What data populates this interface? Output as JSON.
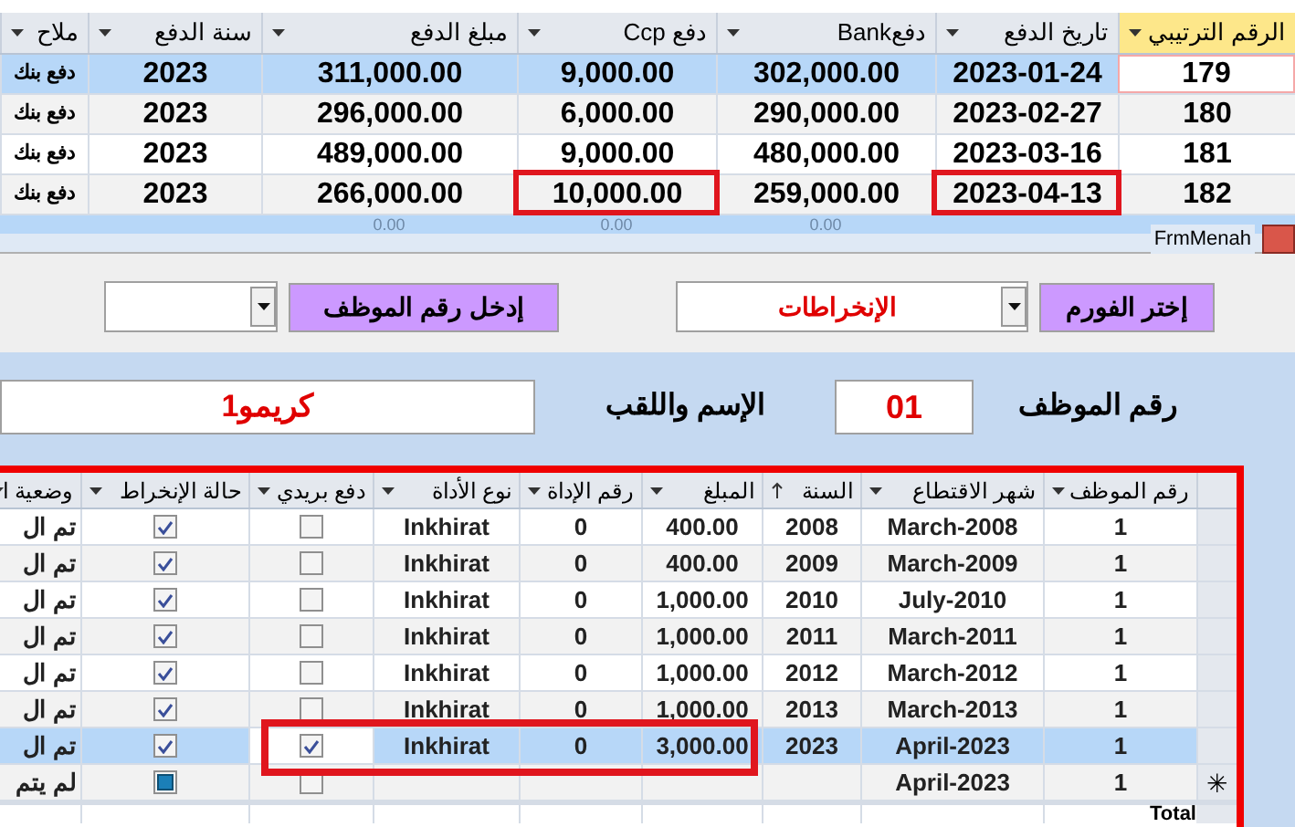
{
  "payments_table": {
    "columns": [
      {
        "label": "الرقم الترتيبي",
        "selected": true
      },
      {
        "label": "تاريخ الدفع",
        "selected": false
      },
      {
        "label": "دفعBank",
        "selected": false
      },
      {
        "label": "دفع Ccp",
        "selected": false
      },
      {
        "label": "مبلغ الدفع",
        "selected": false
      },
      {
        "label": "سنة الدفع",
        "selected": false
      },
      {
        "label": "ملاح",
        "selected": false
      }
    ],
    "rows": [
      {
        "selected": true,
        "cells": [
          "179",
          "2023-01-24",
          "302,000.00",
          "9,000.00",
          "311,000.00",
          "2023",
          "دفع بنك"
        ],
        "date_highlighted": false,
        "ccp_highlighted": false
      },
      {
        "selected": false,
        "cells": [
          "180",
          "2023-02-27",
          "290,000.00",
          "6,000.00",
          "296,000.00",
          "2023",
          "دفع بنك"
        ],
        "date_highlighted": false,
        "ccp_highlighted": false
      },
      {
        "selected": false,
        "cells": [
          "181",
          "2023-03-16",
          "480,000.00",
          "9,000.00",
          "489,000.00",
          "2023",
          "دفع بنك"
        ],
        "date_highlighted": false,
        "ccp_highlighted": false
      },
      {
        "selected": false,
        "cells": [
          "182",
          "2023-04-13",
          "259,000.00",
          "10,000.00",
          "266,000.00",
          "2023",
          "دفع بنك"
        ],
        "date_highlighted": true,
        "ccp_highlighted": true
      }
    ],
    "totals": [
      "0.00",
      "0.00",
      "0.00"
    ]
  },
  "form": {
    "title": "FrmMenah",
    "form_picker": {
      "label": "إختر الفورم",
      "value": "الإنخراطات"
    },
    "employee_picker": {
      "label": "إدخل رقم الموظف"
    },
    "employee_number": {
      "label": "رقم الموظف",
      "value": "01"
    },
    "full_name": {
      "label": "الإسم واللقب",
      "value": "كريمو1"
    }
  },
  "subform": {
    "columns": [
      {
        "label": "رقم الموظف",
        "sorted": false
      },
      {
        "label": "شهر الاقتطاع",
        "sorted": false
      },
      {
        "label": "السنة",
        "sorted": true
      },
      {
        "label": "المبلغ",
        "sorted": false
      },
      {
        "label": "رقم الإداة",
        "sorted": false
      },
      {
        "label": "نوع الأداة",
        "sorted": false
      },
      {
        "label": "دفع بريدي",
        "sorted": false
      },
      {
        "label": "حالة الإنخراط",
        "sorted": false
      },
      {
        "label": "وضعية ا",
        "sorted": false
      }
    ],
    "rows": [
      {
        "selected": false,
        "new_record": false,
        "highlighted": false,
        "employee": "1",
        "month": "March-2008",
        "year": "2008",
        "amount": "400.00",
        "tool_number": "0",
        "tool_type": "Inkhirat",
        "postal": false,
        "enrolled": true,
        "indeterminate": false,
        "status": "تم ال"
      },
      {
        "selected": false,
        "new_record": false,
        "highlighted": false,
        "employee": "1",
        "month": "March-2009",
        "year": "2009",
        "amount": "400.00",
        "tool_number": "0",
        "tool_type": "Inkhirat",
        "postal": false,
        "enrolled": true,
        "indeterminate": false,
        "status": "تم ال"
      },
      {
        "selected": false,
        "new_record": false,
        "highlighted": false,
        "employee": "1",
        "month": "July-2010",
        "year": "2010",
        "amount": "1,000.00",
        "tool_number": "0",
        "tool_type": "Inkhirat",
        "postal": false,
        "enrolled": true,
        "indeterminate": false,
        "status": "تم ال"
      },
      {
        "selected": false,
        "new_record": false,
        "highlighted": false,
        "employee": "1",
        "month": "March-2011",
        "year": "2011",
        "amount": "1,000.00",
        "tool_number": "0",
        "tool_type": "Inkhirat",
        "postal": false,
        "enrolled": true,
        "indeterminate": false,
        "status": "تم ال"
      },
      {
        "selected": false,
        "new_record": false,
        "highlighted": false,
        "employee": "1",
        "month": "March-2012",
        "year": "2012",
        "amount": "1,000.00",
        "tool_number": "0",
        "tool_type": "Inkhirat",
        "postal": false,
        "enrolled": true,
        "indeterminate": false,
        "status": "تم ال"
      },
      {
        "selected": false,
        "new_record": false,
        "highlighted": false,
        "employee": "1",
        "month": "March-2013",
        "year": "2013",
        "amount": "1,000.00",
        "tool_number": "0",
        "tool_type": "Inkhirat",
        "postal": false,
        "enrolled": true,
        "indeterminate": false,
        "status": "تم ال"
      },
      {
        "selected": true,
        "new_record": false,
        "highlighted": true,
        "employee": "1",
        "month": "April-2023",
        "year": "2023",
        "amount": "3,000.00",
        "tool_number": "0",
        "tool_type": "Inkhirat",
        "postal": true,
        "enrolled": true,
        "indeterminate": false,
        "status": "تم ال"
      },
      {
        "selected": false,
        "new_record": true,
        "highlighted": false,
        "employee": "1",
        "month": "April-2023",
        "year": "",
        "amount": "",
        "tool_number": "",
        "tool_type": "",
        "postal": false,
        "enrolled": false,
        "indeterminate": true,
        "status": "لم يتم"
      }
    ],
    "new_row_marker": "✳",
    "total_label": "Total"
  }
}
